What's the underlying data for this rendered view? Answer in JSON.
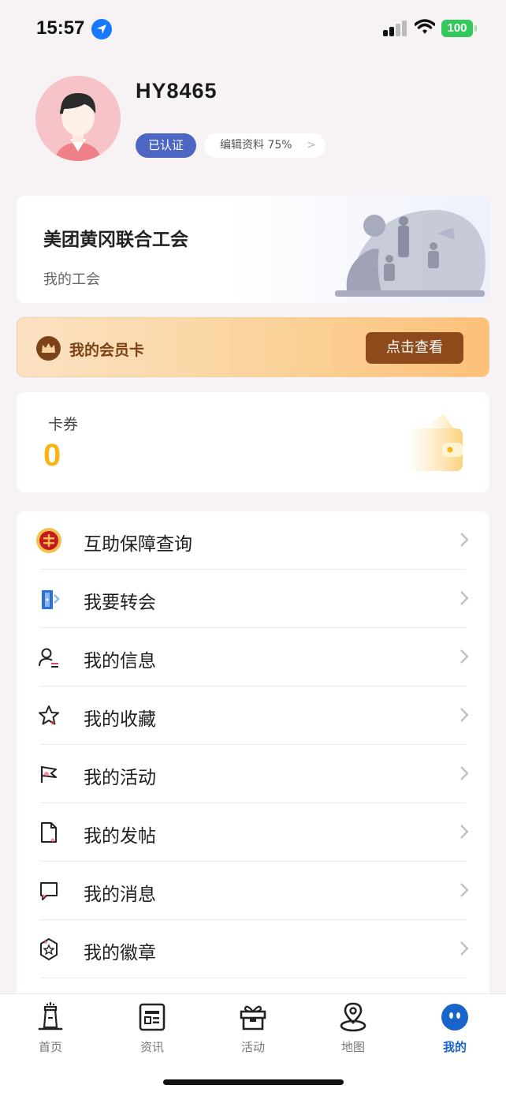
{
  "status_bar": {
    "time": "15:57",
    "battery": "100",
    "icons": [
      "location-arrow-icon",
      "cellular-signal-icon",
      "wifi-icon",
      "battery-icon"
    ]
  },
  "profile": {
    "username": "HY8465",
    "verified_label": "已认证",
    "edit_label": "编辑资料 75%",
    "edit_chevron": ">",
    "avatar_icon": "user-avatar-icon"
  },
  "union_card": {
    "name": "美团黄冈联合工会",
    "subtitle": "我的工会"
  },
  "member_card": {
    "label": "我的会员卡",
    "button": "点击查看",
    "icon": "crown-icon",
    "colors": {
      "text": "#7d4318",
      "button": "#8e4a1b"
    }
  },
  "coupon_card": {
    "label": "卡券",
    "count": "0",
    "icon": "wallet-icon",
    "count_color": "#f5b515"
  },
  "menu": {
    "items": [
      {
        "label": "互助保障查询",
        "icon": "union-emblem-icon"
      },
      {
        "label": "我要转会",
        "icon": "transfer-door-icon"
      },
      {
        "label": "我的信息",
        "icon": "user-info-icon"
      },
      {
        "label": "我的收藏",
        "icon": "star-icon"
      },
      {
        "label": "我的活动",
        "icon": "flag-icon"
      },
      {
        "label": "我的发帖",
        "icon": "document-icon"
      },
      {
        "label": "我的消息",
        "icon": "message-icon"
      },
      {
        "label": "我的徽章",
        "icon": "badge-icon"
      }
    ]
  },
  "tab_bar": {
    "tabs": [
      {
        "label": "首页",
        "icon": "home-tower-icon"
      },
      {
        "label": "资讯",
        "icon": "news-icon"
      },
      {
        "label": "活动",
        "icon": "gift-icon"
      },
      {
        "label": "地图",
        "icon": "map-pin-icon"
      },
      {
        "label": "我的",
        "icon": "profile-face-icon",
        "active": true
      }
    ],
    "active_color": "#1a63c9"
  }
}
